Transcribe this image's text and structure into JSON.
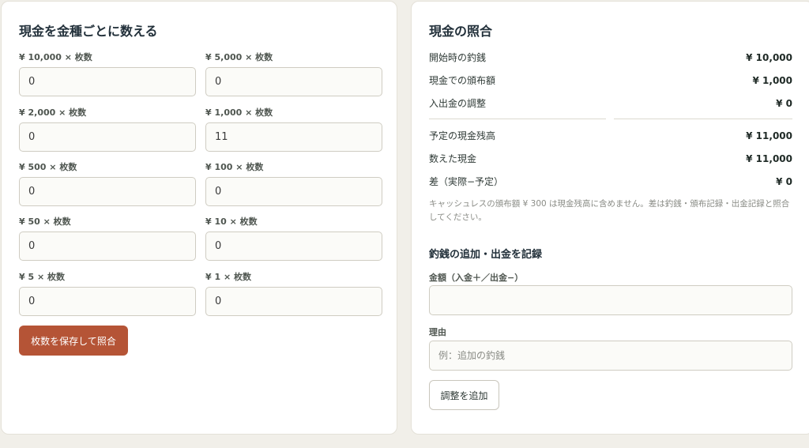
{
  "count_panel": {
    "title": "現金を金種ごとに数える",
    "denominations": [
      {
        "label": "¥ 10,000 × 枚数",
        "value": "0"
      },
      {
        "label": "¥ 5,000 × 枚数",
        "value": "0"
      },
      {
        "label": "¥ 2,000 × 枚数",
        "value": "0"
      },
      {
        "label": "¥ 1,000 × 枚数",
        "value": "11"
      },
      {
        "label": "¥ 500 × 枚数",
        "value": "0"
      },
      {
        "label": "¥ 100 × 枚数",
        "value": "0"
      },
      {
        "label": "¥ 50 × 枚数",
        "value": "0"
      },
      {
        "label": "¥ 10 × 枚数",
        "value": "0"
      },
      {
        "label": "¥ 5 × 枚数",
        "value": "0"
      },
      {
        "label": "¥ 1 × 枚数",
        "value": "0"
      }
    ],
    "save_button": "枚数を保存して照合"
  },
  "recon_panel": {
    "title": "現金の照合",
    "rows": [
      {
        "label": "開始時の釣銭",
        "value": "¥ 10,000"
      },
      {
        "label": "現金での頒布額",
        "value": "¥ 1,000"
      },
      {
        "label": "入出金の調整",
        "value": "¥ 0"
      },
      {
        "label": "予定の現金残高",
        "value": "¥ 11,000"
      },
      {
        "label": "数えた現金",
        "value": "¥ 11,000"
      },
      {
        "label": "差（実際−予定）",
        "value": "¥ 0"
      }
    ],
    "note": "キャッシュレスの頒布額 ¥ 300 は現金残高に含めません。差は釣銭・頒布記録・出金記録と照合してください。",
    "adjust_section": {
      "title": "釣銭の追加・出金を記録",
      "amount_label": "金額（入金＋／出金−）",
      "amount_value": "",
      "reason_label": "理由",
      "reason_placeholder": "例：追加の釣銭",
      "add_button": "調整を追加"
    }
  }
}
